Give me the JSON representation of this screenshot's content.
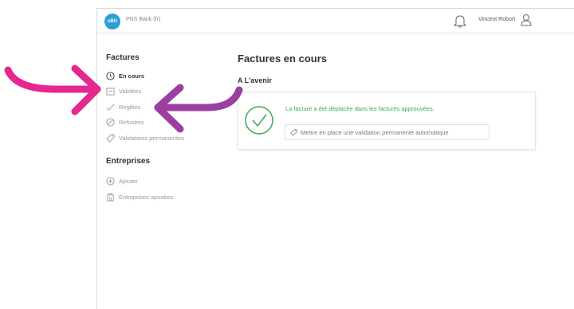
{
  "header": {
    "logo_text": "sBU",
    "bank_name": "PNS Bank (fr)",
    "user_name": "Vincent Robort"
  },
  "sidebar": {
    "invoices_title": "Factures",
    "invoice_items": [
      {
        "label": "En cours",
        "icon": "clock-icon",
        "active": true
      },
      {
        "label": "Validées",
        "icon": "calendar-icon",
        "active": false
      },
      {
        "label": "Reglées",
        "icon": "checkmark-icon",
        "active": false
      },
      {
        "label": "Refusées",
        "icon": "refused-icon",
        "active": false
      },
      {
        "label": "Validations permanentes",
        "icon": "tag-icon",
        "active": false
      }
    ],
    "companies_title": "Entreprises",
    "company_items": [
      {
        "label": "Ajouter",
        "icon": "add-circle-icon"
      },
      {
        "label": "Entreprises ajoutées",
        "icon": "building-icon"
      }
    ]
  },
  "main": {
    "title": "Factures en cours",
    "section_title": "A L'avenir",
    "notice": {
      "message": "La facture a été déplacée dans les factures approuvées.",
      "action_label": "Mettre en place une validation permanente automatique"
    }
  },
  "colors": {
    "accent_blue": "#2e9fd6",
    "success_green": "#3aa94a",
    "annotation_pink": "#e5278f",
    "annotation_purple": "#9b3fa3"
  }
}
